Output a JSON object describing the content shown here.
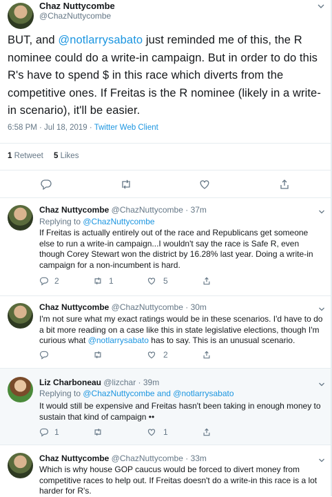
{
  "main": {
    "name": "Chaz Nuttycombe",
    "handle": "@ChazNuttycombe",
    "text_1": "BUT, and ",
    "mention": "@notlarrysabato",
    "text_2": " just reminded me of this, the R nominee could do a write-in campaign. But in order to do this R's have to spend $ in this race which diverts from the competitive ones. If Freitas is the R nominee (likely in a write-in scenario), it'll be easier.",
    "timestamp": "6:58 PM · Jul 18, 2019 · ",
    "client": "Twitter Web Client",
    "retweet_count": "1",
    "retweet_label": " Retweet",
    "likes_count": "5",
    "likes_label": " Likes"
  },
  "replies": [
    {
      "name": "Chaz Nuttycombe",
      "handle_time": " @ChazNuttycombe · 37m",
      "replying_prefix": "Replying to ",
      "replying_to": "@ChazNuttycombe",
      "text": "If Freitas is actually entirely out of the race and Republicans get someone else to run a write-in campaign...I wouldn't say the race is Safe R, even though Corey Stewart won the district by 16.28% last year. Doing a write-in campaign for a non-incumbent is hard.",
      "reply_count": "2",
      "retweet_count": "1",
      "like_count": "5"
    },
    {
      "name": "Chaz Nuttycombe",
      "handle_time": " @ChazNuttycombe · 30m",
      "text_1": "I'm not sure what my exact ratings would be in these scenarios. I'd have to do a bit more reading on a case like this in state legislative elections, though I'm curious what ",
      "mention": "@notlarrysabato",
      "text_2": " has to say. This is an unusual scenario.",
      "like_count": "2"
    },
    {
      "name": "Liz Charboneau",
      "handle_time": " @lizchar · 39m",
      "replying_prefix": "Replying to ",
      "replying_to": "@ChazNuttycombe and @notlarrysabato",
      "text": "It would still be expensive and Freitas hasn't been taking in enough money to sustain that kind of campaign ••",
      "reply_count": "1",
      "like_count": "1"
    },
    {
      "name": "Chaz Nuttycombe",
      "handle_time": " @ChazNuttycombe · 33m",
      "text": "Which is why house GOP caucus would be forced to divert money from competitive races to help out. If Freitas doesn't do a write-in this race is a lot harder for R's."
    }
  ],
  "colors": {
    "accent": "#1b95e0",
    "muted": "#657786",
    "text": "#14171a",
    "border": "#e6ecf0",
    "highlight": "#f5f8fa"
  },
  "icons": [
    "reply-icon",
    "retweet-icon",
    "like-icon",
    "share-icon",
    "chevron-down-icon"
  ]
}
